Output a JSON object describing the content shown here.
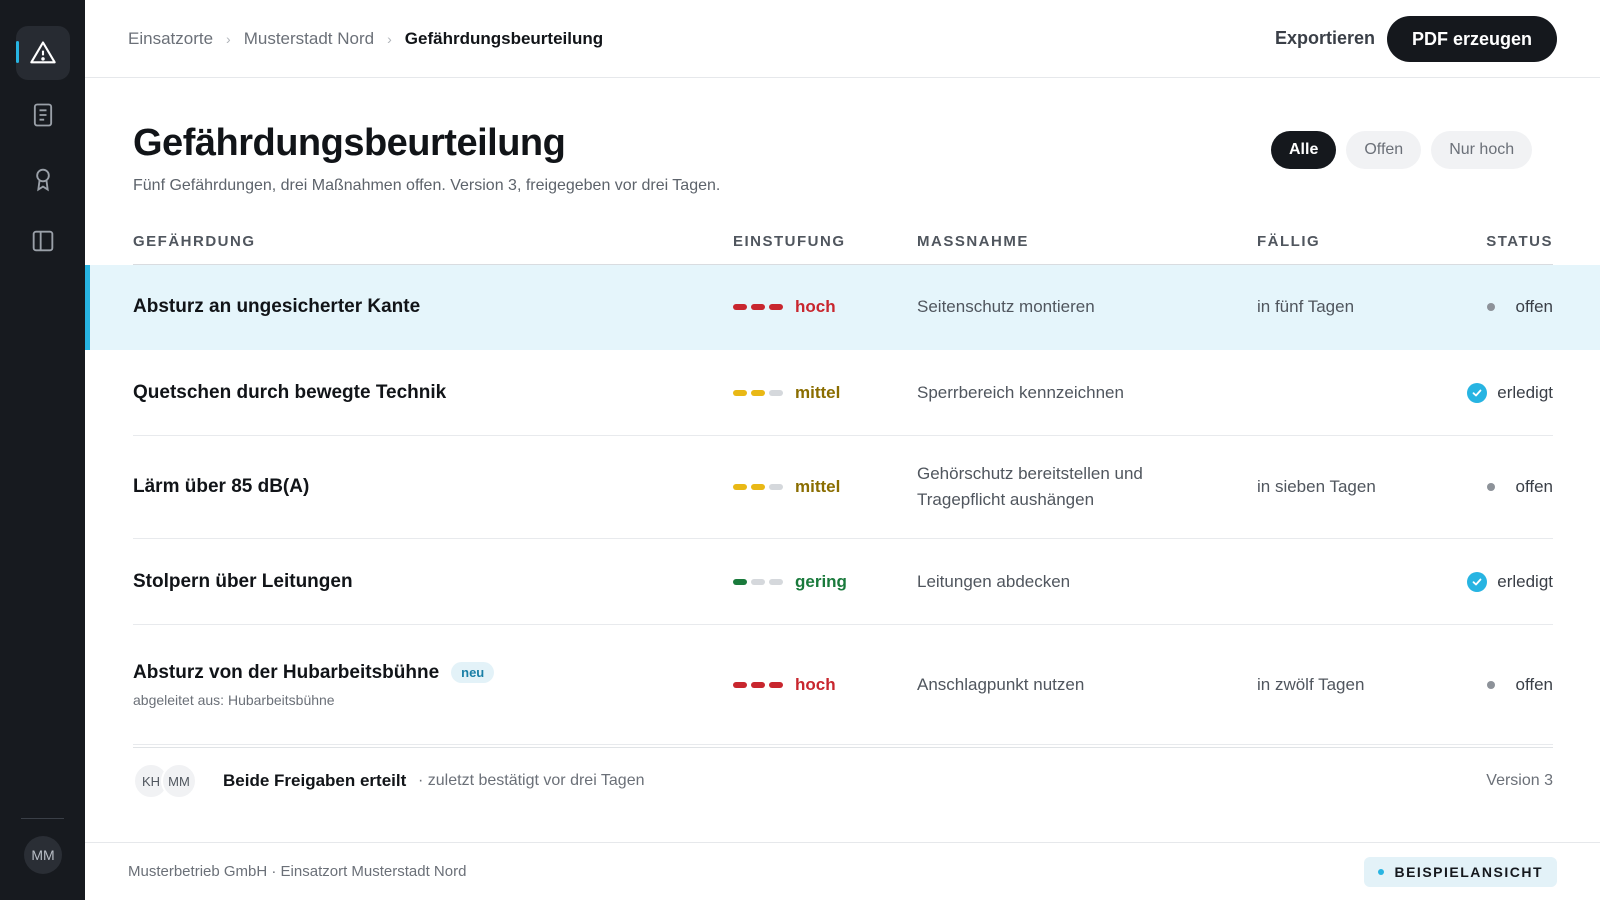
{
  "sidebar": {
    "items": [
      {
        "icon": "warning-icon",
        "active": true
      },
      {
        "icon": "document-icon",
        "active": false
      },
      {
        "icon": "award-icon",
        "active": false
      },
      {
        "icon": "panel-icon",
        "active": false
      }
    ],
    "user_initials": "MM"
  },
  "header": {
    "breadcrumb": [
      "Einsatzorte",
      "Musterstadt Nord",
      "Gefährdungsbeurteilung"
    ],
    "export_label": "Exportieren",
    "pdf_label": "PDF erzeugen"
  },
  "page": {
    "title": "Gefährdungsbeurteilung",
    "subtitle": "Fünf Gefährdungen, drei Maßnahmen offen. Version 3, freigegeben vor drei Tagen."
  },
  "filters": [
    "Alle",
    "Offen",
    "Nur hoch"
  ],
  "active_filter": "Alle",
  "table": {
    "columns": [
      "GEFÄHRDUNG",
      "EINSTUFUNG",
      "MASSNAHME",
      "FÄLLIG",
      "STATUS"
    ],
    "rows": [
      {
        "hazard": "Absturz an ungesicherter Kante",
        "level": "hoch",
        "level_count": 3,
        "level_color": "#c8262e",
        "action": "Seitenschutz montieren",
        "due": "in fünf Tagen",
        "status": "offen",
        "done": false,
        "highlight": true
      },
      {
        "hazard": "Quetschen durch bewegte Technik",
        "level": "mittel",
        "level_count": 2,
        "level_color": "#e9b816",
        "level_text_color": "#8a6d00",
        "action": "Sperrbereich kennzeichnen",
        "due": "",
        "status": "erledigt",
        "done": true
      },
      {
        "hazard": "Lärm über 85 dB(A)",
        "level": "mittel",
        "level_count": 2,
        "level_color": "#e9b816",
        "level_text_color": "#8a6d00",
        "action_lines": [
          "Gehörschutz bereitstellen und",
          "Tragepflicht aushängen"
        ],
        "due": "in sieben Tagen",
        "status": "offen",
        "done": false
      },
      {
        "hazard": "Stolpern über Leitungen",
        "level": "gering",
        "level_count": 1,
        "level_color": "#1a7a3c",
        "action": "Leitungen abdecken",
        "due": "",
        "status": "erledigt",
        "done": true
      },
      {
        "hazard": "Absturz von der Hubarbeitsbühne",
        "badge": "neu",
        "derived": "abgeleitet aus: Hubarbeitsbühne",
        "level": "hoch",
        "level_count": 3,
        "level_color": "#c8262e",
        "action": "Anschlagpunkt nutzen",
        "due": "in zwölf Tagen",
        "status": "offen",
        "done": false
      }
    ]
  },
  "approval": {
    "initials": [
      "KH",
      "MM"
    ],
    "title": "Beide Freigaben erteilt",
    "note": "· zuletzt bestätigt vor drei Tagen",
    "version": "Version 3"
  },
  "footer": {
    "company": "Musterbetrieb GmbH · Einsatzort Musterstadt Nord",
    "demo_badge": "BEISPIELANSICHT"
  },
  "colors": {
    "accent": "#27b4e2",
    "high": "#c8262e",
    "medium": "#e9b816",
    "low": "#1a7a3c"
  }
}
